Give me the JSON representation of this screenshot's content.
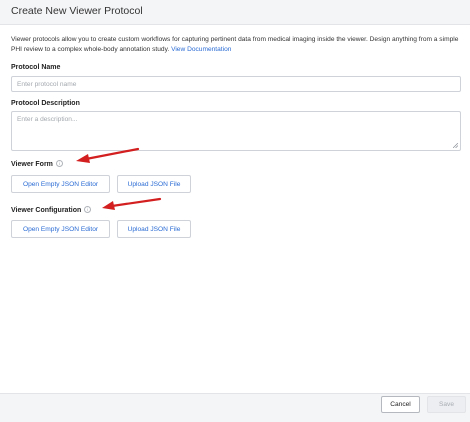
{
  "dialog": {
    "title": "Create New Viewer Protocol",
    "intro_text": "Viewer protocols allow you to create custom workflows for capturing pertinent data from medical imaging inside the viewer. Design anything from a simple PHI review to a complex whole-body annotation study.",
    "doc_link": "View Documentation"
  },
  "fields": {
    "name_label": "Protocol Name",
    "name_placeholder": "Enter protocol name",
    "name_value": "",
    "description_label": "Protocol Description",
    "description_placeholder": "Enter a description...",
    "description_value": ""
  },
  "viewer_form": {
    "label": "Viewer Form",
    "info_icon": "info-circle-icon",
    "open_editor_label": "Open Empty JSON Editor",
    "upload_label": "Upload JSON File"
  },
  "viewer_configuration": {
    "label": "Viewer Configuration",
    "info_icon": "info-circle-icon",
    "open_editor_label": "Open Empty JSON Editor",
    "upload_label": "Upload JSON File"
  },
  "footer": {
    "cancel_label": "Cancel",
    "save_label": "Save"
  },
  "annotations": {
    "arrow_color": "#d31f1f"
  },
  "colors": {
    "accent": "#2a6bd4",
    "header_bg": "#f4f5f7",
    "border": "#cfd3d9"
  }
}
